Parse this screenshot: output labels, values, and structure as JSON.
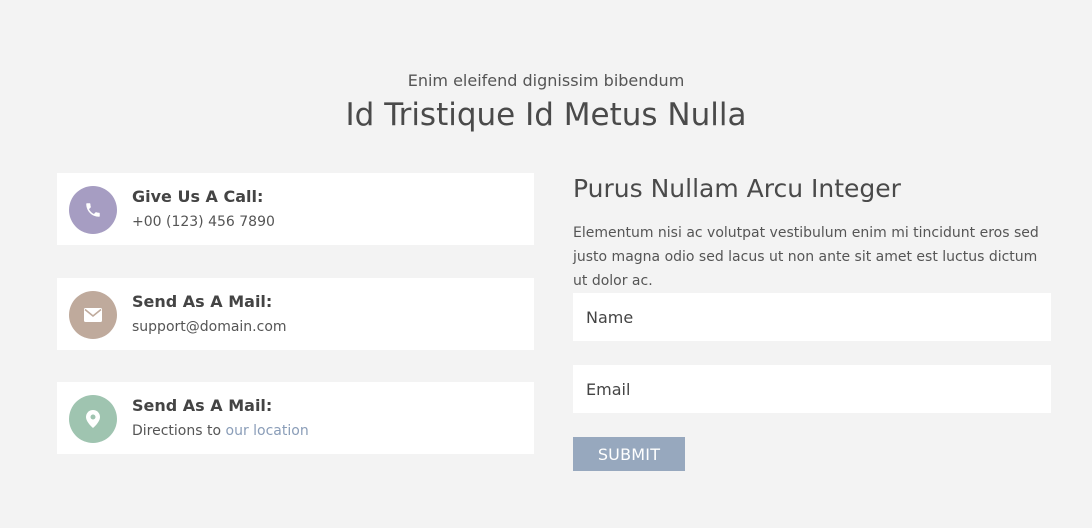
{
  "header": {
    "subtitle": "Enim eleifend dignissim bibendum",
    "title": "Id Tristique Id Metus Nulla"
  },
  "contacts": [
    {
      "icon": "phone-icon",
      "color": "#a69dc2",
      "title": "Give Us A Call:",
      "text": "+00 (123) 456 7890"
    },
    {
      "icon": "mail-icon",
      "color": "#bfaa9c",
      "title": "Send As A Mail:",
      "text": "support@domain.com"
    },
    {
      "icon": "location-pin-icon",
      "color": "#9fc4b0",
      "title": "Send As A Mail:",
      "text_prefix": "Directions to ",
      "link": "our location",
      "link_color": "#8a9db8"
    }
  ],
  "form": {
    "heading": "Purus Nullam Arcu Integer",
    "description": "Elementum nisi ac volutpat vestibulum enim mi tincidunt eros sed justo magna odio sed lacus ut non ante sit amet est luctus dictum ut dolor ac.",
    "name_placeholder": "Name",
    "email_placeholder": "Email",
    "submit_label": "SUBMIT",
    "submit_color": "#97a8be"
  }
}
